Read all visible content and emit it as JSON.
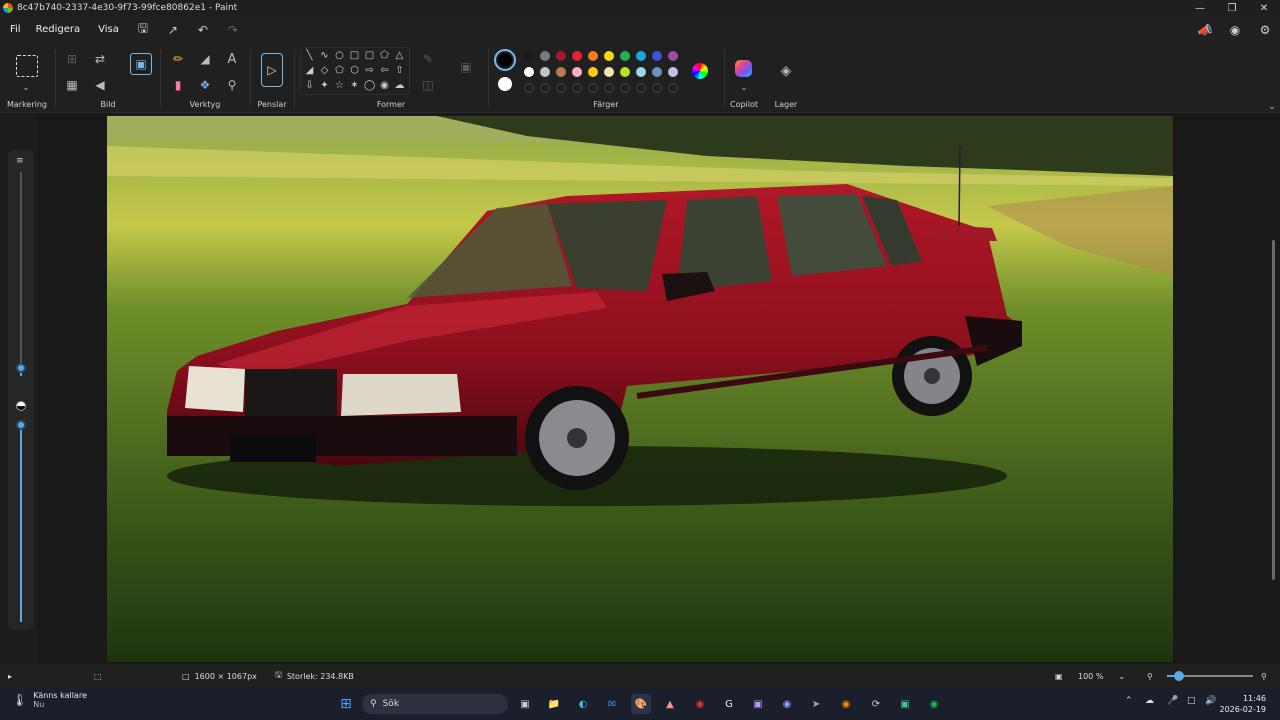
{
  "window": {
    "title": "8c47b740-2337-4e30-9f73-99fce80862e1 - Paint",
    "minimize_icon": "minimize-icon",
    "maximize_icon": "restore-icon",
    "close_icon": "close-icon"
  },
  "menubar": {
    "file_label": "Fil",
    "edit_label": "Redigera",
    "view_label": "Visa"
  },
  "ribbon": {
    "groups": {
      "selection": "Markering",
      "image": "Bild",
      "tools": "Verktyg",
      "brushes": "Penslar",
      "shapes": "Former",
      "colors": "Färger",
      "copilot": "Copilot",
      "layers": "Lager"
    },
    "palette_row1": [
      "#1a1a1a",
      "#7a7a7a",
      "#a3182a",
      "#e8222c",
      "#f57c20",
      "#fbd80c",
      "#22b14c",
      "#17a8e3",
      "#3f51d8",
      "#a349a4"
    ],
    "palette_row2": [
      "#ffffff",
      "#c3c3c3",
      "#b97a57",
      "#ffaec9",
      "#ffc90e",
      "#efe4b0",
      "#b5e61d",
      "#99d9ea",
      "#7092be",
      "#c8bfe7"
    ],
    "primary_color": "#000000",
    "secondary_color": "#ffffff"
  },
  "status": {
    "image_size": "1600 × 1067px",
    "file_size": "Storlek: 234.8KB",
    "zoom": "100 %"
  },
  "taskbar": {
    "weather_title": "Känns kallare",
    "weather_sub": "Nu",
    "search_placeholder": "Sök",
    "time": "11:46",
    "date": "2026-02-19"
  },
  "canvas": {
    "image": "red-sedan-on-grass-field"
  }
}
